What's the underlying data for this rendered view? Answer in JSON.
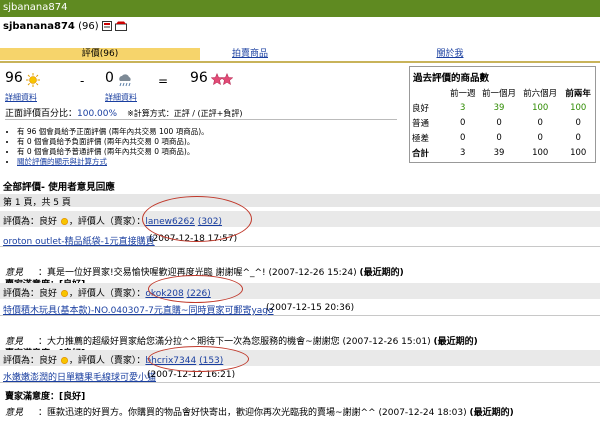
{
  "header": {
    "window_title": "sjbanana874",
    "username": "sjbanana874",
    "score_badge": "(96)"
  },
  "tabs": [
    {
      "label": "評價(96)"
    },
    {
      "label": "拍賣商品"
    },
    {
      "label": "關於我"
    }
  ],
  "score": {
    "positive": "96",
    "positive_link": "詳細資料",
    "dash": "-",
    "negative": "0",
    "negative_link": "詳細資料",
    "equals": "=",
    "total": "96",
    "percent_label": "正面評價百分比：",
    "percent_value": "100.00%",
    "percent_note": "※計算方式：正評 / (正評+負評)"
  },
  "notes": [
    "有 96 個會員給予正面評價 (兩年內共交易 100 項商品)。",
    "有 0 個會員給予負面評價 (兩年內共交易 0 項商品)。",
    "有 0 個會員給予普通評價 (兩年內共交易 0 項商品)。",
    "關於評價的顯示與計算方式"
  ],
  "past_ratings": {
    "title": "過去評價的商品數",
    "columns": [
      "",
      "前一週",
      "前一個月",
      "前六個月",
      "前兩年"
    ],
    "rows": [
      {
        "label": "良好",
        "values": [
          "3",
          "39",
          "100",
          "100"
        ]
      },
      {
        "label": "普通",
        "values": [
          "0",
          "0",
          "0",
          "0"
        ]
      },
      {
        "label": "極差",
        "values": [
          "0",
          "0",
          "0",
          "0"
        ]
      },
      {
        "label": "合計",
        "values": [
          "3",
          "39",
          "100",
          "100"
        ]
      }
    ]
  },
  "section_title": "全部評價- 使用者意見回應",
  "pagination": "第 1 頁，共 5 頁",
  "ratings": [
    {
      "rate_prefix": "評價為：良好",
      "rate_suffix": "，評價人（賣家）：",
      "rater": "lanew6262",
      "rater_count": "(302)",
      "item": "oroton outlet-精品紙袋-1元直接購買",
      "item_date": "(2007-12-18 17:57)",
      "comment_label": "意見",
      "comment": "：真是一位好買家!交易愉快喔歡迎再度光臨 謝謝喔^_^!",
      "comment_date": "(2007-12-26 15:24)",
      "latest": "(最近期的)",
      "reply": "賣家滿意度：[良好]"
    },
    {
      "rate_prefix": "評價為：良好",
      "rate_suffix": "，評價人（賣家）：",
      "rater": "okok208",
      "rater_count": "(226)",
      "item": "特價積木玩具(基本款)-NO.040307-7元直購~同時買家可郵寄yago",
      "item_date": "(2007-12-15 20:36)",
      "comment_label": "意見",
      "comment": "：大力推薦的超級好買家給您滿分拉^^期待下一次為您服務的機會~謝謝您",
      "comment_date": "(2007-12-26 15:01)",
      "latest": "(最近期的)",
      "reply": "賣家滿意度：[良好]"
    },
    {
      "rate_prefix": "評價為：良好",
      "rate_suffix": "，評價人（賣家）：",
      "rater": "bhcrix7344",
      "rater_count": "(153)",
      "item": "水嫩嫩澎潤的日單糖果毛線球可愛小猫",
      "item_date": "(2007-12-12 16:21)",
      "comment_label": "意見",
      "comment": "：匯款迅速的好買方。你購買的物品會好快寄出，歡迎你再次光臨我的賣場~謝謝^^",
      "comment_date": "(2007-12-24 18:03)",
      "latest": "(最近期的)",
      "reply": "賣家滿意度：[良好]"
    }
  ]
}
